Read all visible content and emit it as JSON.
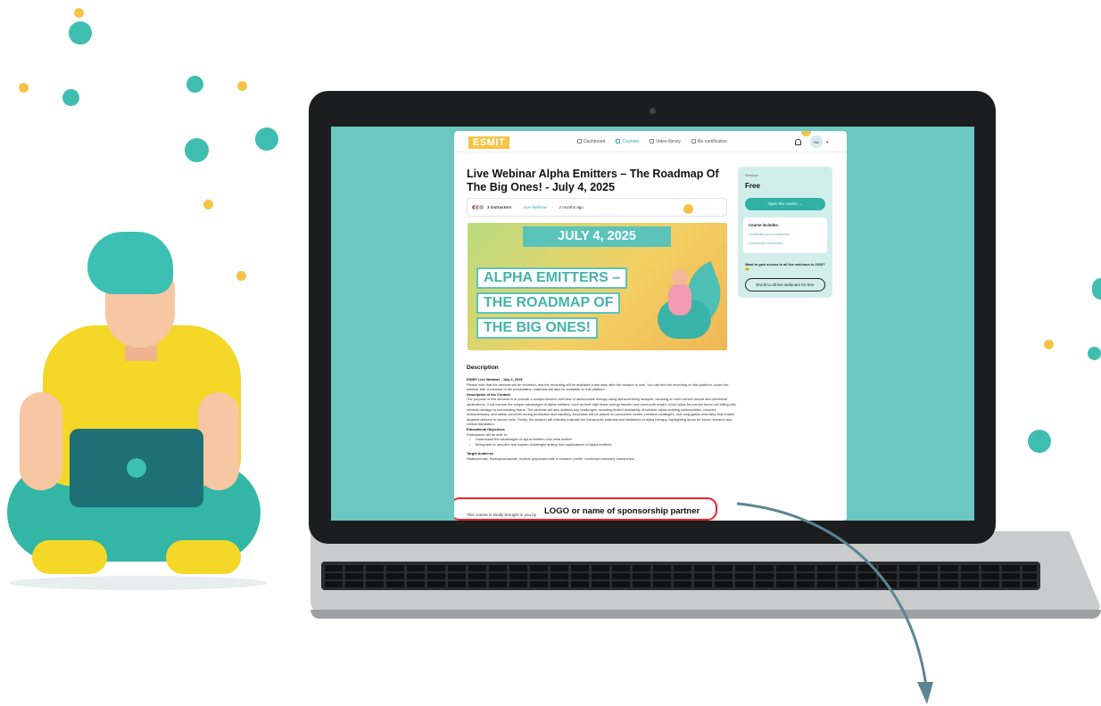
{
  "colors": {
    "accent": "#2fb1a4",
    "brand": "#f6c445",
    "highlight": "#e5262b",
    "screen_bg": "#6cc7c2"
  },
  "header": {
    "brand": "ESMIT",
    "nav": {
      "dashboard": "Dashboard",
      "courses": "Courses",
      "video_library": "Video library",
      "recertification": "Re-certification"
    },
    "avatar_initials": "NA",
    "caret": "▾"
  },
  "course": {
    "title": "Live Webinar Alpha Emitters – The Roadmap Of The Big Ones! - July 4, 2025",
    "instructors": "3 instructors",
    "type": "Live Webinar",
    "posted": "2 months ago"
  },
  "banner": {
    "date": "JULY 4, 2025",
    "line1": "ALPHA EMITTERS –",
    "line2": "THE ROADMAP OF",
    "line3": "THE BIG ONES!"
  },
  "description": {
    "heading": "Description",
    "subtitle": "ESMIT Live Webinar - July 4, 2025",
    "note": "Please note that the webinar will be recorded, and the recording will be available a few days after the session is over. You can find the recording on this platform, under the webinar title. A handout of the presentation materials will also be available on this platform.",
    "content_h": "Description of the Content",
    "content": "The purpose of this seminar is to provide a comprehensive overview of radionuclide therapy using alpha-emitting isotopes, focusing on their current clinical and preclinical applications. It will explore the unique advantages of alpha emitters, such as their high linear energy transfer and short path length, which allow for precise tumor cell killing with minimal damage to surrounding tissue. The seminar will also address key challenges, including limited availability of suitable alpha emitting radionuclides, complex radiochemistry, and safety concerns during production and handling. Emphasis will be placed on production routes, chelation strategies, and conjugation chemistry that enable targeted delivery to cancer cells. Finally, the session will critically evaluate the therapeutic potential and limitations of alpha therapy, highlighting areas for future research and clinical translation.",
    "objectives_h": "Educational Objectives",
    "objectives_intro": "Participants will be able to:",
    "objective1": "Understand the advantages of alpha emitters over beta emitter",
    "objective2": "Being able to describe and explain challenges arising from applications of alpha emitters.",
    "audience_h": "Target Audience",
    "audience": "Radiochemist, Radiopharmacists, nuclear physicians with a research profile, medicinal chemistry researchers"
  },
  "sponsor": {
    "lead": "This course is kindly brought to you by",
    "placeholder": "LOGO or name of sponsorship partner"
  },
  "sidebar": {
    "label": "Webinar",
    "price": "Free",
    "open_button": "Open the course →",
    "includes_h": "Course includes:",
    "include1": "Certificate upon completion",
    "include2": "Community discussion",
    "upsell": "Want to gain access to all live webinars in 2025? 😉",
    "enroll_button": "Enroll to all live webinars for free"
  }
}
